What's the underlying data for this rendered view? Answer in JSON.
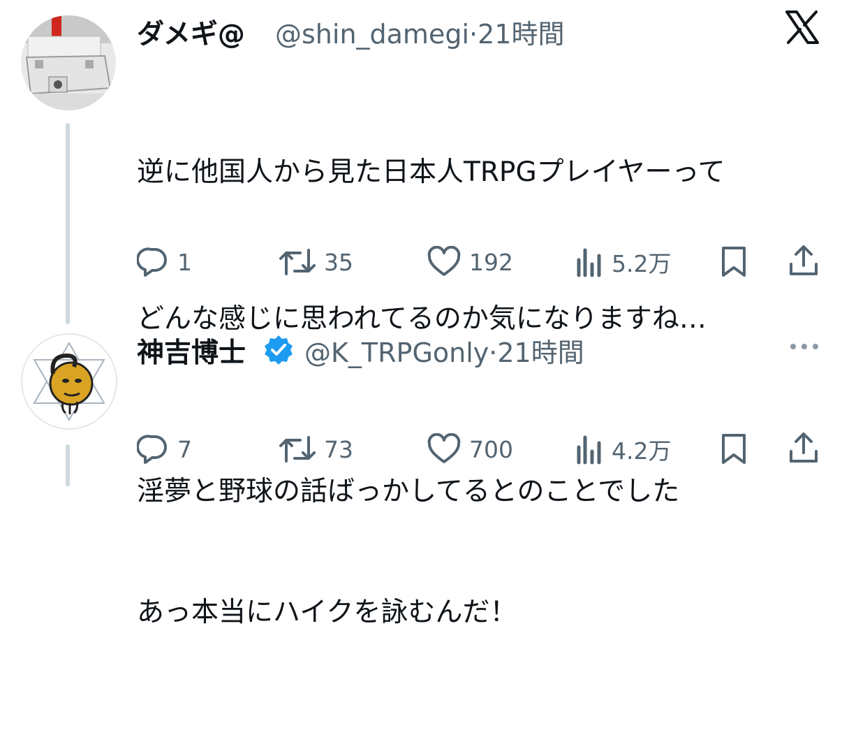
{
  "tweets": [
    {
      "display_name": "ダメギ@",
      "handle": "@shin_damegi",
      "separator": "·",
      "time": "21時間",
      "verified": false,
      "avatar": "robot-model-avatar",
      "text_lines": [
        "逆に他国人から見た日本人TRPGプレイヤーって",
        "どんな感じに思われてるのか気になりますね…",
        "",
        "あっ本当にハイクを詠むんだ！"
      ],
      "stats": {
        "replies": "1",
        "retweets": "35",
        "likes": "192",
        "views": "5.2万"
      }
    },
    {
      "display_name": "神吉博士",
      "handle": "@K_TRPGonly",
      "separator": "·",
      "time": "21時間",
      "verified": true,
      "avatar": "star-moon-face-avatar",
      "text_lines": [
        "淫夢と野球の話ばっかしてるとのことでした"
      ],
      "stats": {
        "replies": "7",
        "retweets": "73",
        "likes": "700",
        "views": "4.2万"
      }
    }
  ],
  "icons": {
    "brand": "x-logo-icon",
    "reply": "reply-icon",
    "retweet": "retweet-icon",
    "like": "heart-icon",
    "views": "views-icon",
    "bookmark": "bookmark-icon",
    "share": "share-icon",
    "more": "more-icon",
    "verified": "verified-badge-icon"
  },
  "colors": {
    "text": "#0f1419",
    "secondary": "#536471",
    "verified": "#1d9bf0",
    "thread_line": "#cfd9de"
  }
}
